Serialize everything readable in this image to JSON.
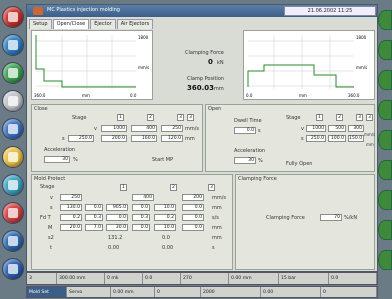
{
  "app_title": "MC Plastics injection molding",
  "datetime": "21.06.2002 11:25",
  "tabs": [
    "Setup",
    "Open/Close",
    "Ejector",
    "Air Ejectors"
  ],
  "left_buttons": [
    "#c9302a",
    "#2a7fc2",
    "#3aa050",
    "#d0d4d8",
    "#3a70c0",
    "#e8c040",
    "#3aa0c0",
    "#d04040",
    "#2a6ab0",
    "#2a60b0"
  ],
  "graph_left": {
    "ymax": "1800",
    "yunit": "mm/s",
    "xmin": "360.0",
    "xunit": "mm",
    "xmax": "0.0"
  },
  "graph_right": {
    "ymax": "1800",
    "yunit": "mm/s",
    "xmin": "0.0",
    "xunit": "mm",
    "xmax": "360.0"
  },
  "clamping": {
    "label": "Clamping Force",
    "value": "0",
    "unit": "kN",
    "pos_label": "Clamp Position",
    "pos_value": "360.03",
    "pos_unit": "mm"
  },
  "close": {
    "title": "Close",
    "stage_label": "Stage",
    "stages": [
      "1",
      "2",
      "3",
      "3"
    ],
    "v_label": "v",
    "v": [
      "1000",
      "400",
      "250"
    ],
    "v_unit": "mm/s",
    "s_label": "s",
    "s_first": "250.0",
    "s": [
      "200.0",
      "160.0",
      "120.0"
    ],
    "s_unit": "mm",
    "acc_label": "Acceleration",
    "acc_value": "30",
    "acc_unit": "%",
    "start_mp": "Start MP"
  },
  "open": {
    "title": "Open",
    "stage_label": "Stage",
    "stages": [
      "1",
      "2",
      "3",
      "3"
    ],
    "v_label": "v",
    "v": [
      "1000",
      "500",
      "300"
    ],
    "v_unit": "mm/s",
    "s_label": "s",
    "s": [
      "250.0",
      "100.0",
      "150.0"
    ],
    "s_unit": "mm",
    "dwell_label": "Dwell Time",
    "dwell_value": "0.0",
    "dwell_unit": "s",
    "acc_label": "Acceleration",
    "acc_value": "30",
    "acc_unit": "%",
    "fully_open": "Fully Open"
  },
  "mold_protect": {
    "title": "Mold Protect",
    "stage_label": "Stage",
    "stages": [
      "1",
      "2",
      "3"
    ],
    "rows": [
      {
        "label": "v",
        "values": [
          "250",
          "400",
          "200"
        ],
        "unit": "mm/s"
      },
      {
        "label": "s",
        "values": [
          "130.0",
          "0.0",
          "905.0",
          "0.0",
          "10.0",
          "0.0"
        ],
        "unit": "mm"
      },
      {
        "label": "Fd T",
        "values": [
          "0.2",
          "0.3",
          "0.0",
          "0.3",
          "0.2",
          "0.0"
        ],
        "unit": "s/s"
      },
      {
        "label": "M",
        "values": [
          "20.0",
          "7.0",
          "30.0",
          "0.0",
          "10.0",
          "0.0"
        ],
        "unit": "mm"
      },
      {
        "label": "s2",
        "values": [
          "131.2",
          "",
          "0.0"
        ],
        "unit": "mm"
      },
      {
        "label": "t",
        "values": [
          "0.00",
          "",
          "0.00"
        ],
        "unit": "s"
      }
    ]
  },
  "clamp_force_panel": {
    "title": "Clamping Force",
    "label": "Clamping Force",
    "value": "70",
    "unit": "%/kN"
  },
  "status1": [
    "3",
    "300.00 mm",
    "0 mk",
    "0.0",
    "270",
    "0.00 mm",
    "15 bar",
    "0.0"
  ],
  "status2": [
    "Mold Set",
    "Servo",
    "0.00 mm",
    "0",
    "2000",
    "0.00",
    "0"
  ]
}
